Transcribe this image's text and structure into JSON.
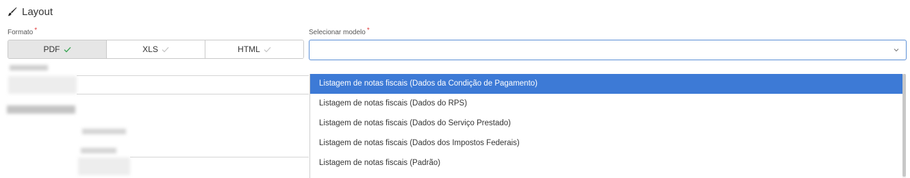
{
  "section": {
    "title": "Layout",
    "icon": "brush-icon"
  },
  "formato": {
    "label": "Formato",
    "required_mark": "*",
    "options": [
      {
        "label": "PDF",
        "selected": true
      },
      {
        "label": "XLS",
        "selected": false
      },
      {
        "label": "HTML",
        "selected": false
      }
    ]
  },
  "modelo": {
    "label": "Selecionar modelo",
    "required_mark": "*",
    "value": "",
    "open": true,
    "options": [
      {
        "label": "Listagem de notas fiscais (Dados da Condição de Pagamento)",
        "highlighted": true
      },
      {
        "label": "Listagem de notas fiscais (Dados do RPS)",
        "highlighted": false
      },
      {
        "label": "Listagem de notas fiscais (Dados do Serviço Prestado)",
        "highlighted": false
      },
      {
        "label": "Listagem de notas fiscais (Dados dos Impostos Federais)",
        "highlighted": false
      },
      {
        "label": "Listagem de notas fiscais (Padrão)",
        "highlighted": false
      }
    ]
  },
  "colors": {
    "accent": "#3d7ad6",
    "check_active": "#3aa655",
    "check_inactive": "#c4c4c4",
    "required": "#e03a3a"
  }
}
